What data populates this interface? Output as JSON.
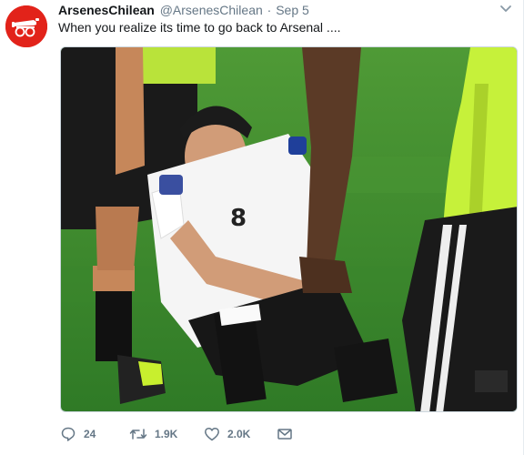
{
  "tweet": {
    "author_name": "ArsenesChilean",
    "author_handle": "@ArsenesChilean",
    "separator": "·",
    "timestamp": "Sep 5",
    "text": "When you realize its time to go back to Arsenal ....",
    "avatar_icon": "cannon-icon",
    "avatar_color": "#e2231a"
  },
  "actions": {
    "reply_count": "24",
    "retweet_count": "1.9K",
    "like_count": "2.0K",
    "reply_icon": "reply-icon",
    "retweet_icon": "retweet-icon",
    "like_icon": "heart-icon",
    "dm_icon": "envelope-icon"
  },
  "media": {
    "jersey_number": "8",
    "jersey_color": "#ffffff",
    "opponent_color": "#c6f13a",
    "pitch_color": "#3f8f2c"
  }
}
